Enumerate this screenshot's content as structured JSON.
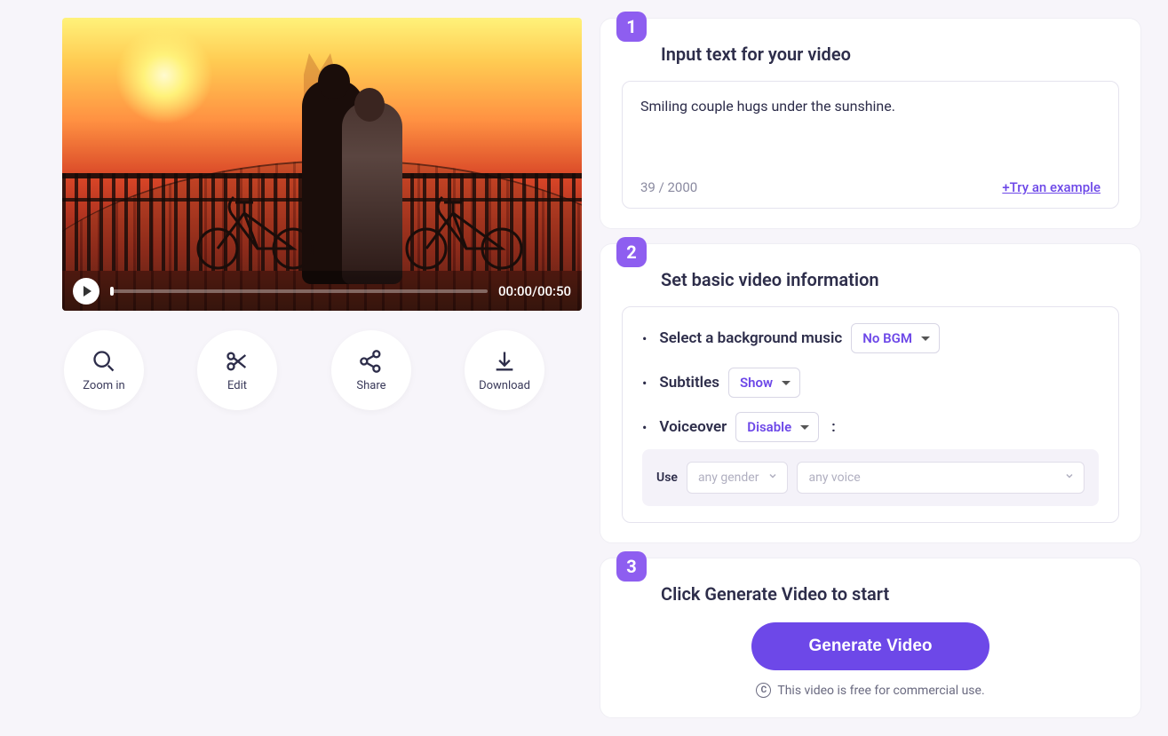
{
  "video": {
    "current_time": "00:00",
    "duration": "00:50"
  },
  "actions": {
    "zoom_label": "Zoom in",
    "edit_label": "Edit",
    "share_label": "Share",
    "download_label": "Download"
  },
  "step1": {
    "badge": "1",
    "title": "Input text for your video",
    "text_value": "Smiling couple hugs under the sunshine.",
    "char_count": "39 / 2000",
    "try_example": "+Try an example"
  },
  "step2": {
    "badge": "2",
    "title": "Set basic video information",
    "bgm_label": "Select a background music",
    "bgm_value": "No BGM",
    "subtitles_label": "Subtitles",
    "subtitles_value": "Show",
    "voiceover_label": "Voiceover",
    "voiceover_value": "Disable",
    "use_label": "Use",
    "gender_placeholder": "any gender",
    "voice_placeholder": "any voice"
  },
  "step3": {
    "badge": "3",
    "title": "Click Generate Video to start",
    "button_label": "Generate Video",
    "footer_note": "This video is free for commercial use."
  }
}
